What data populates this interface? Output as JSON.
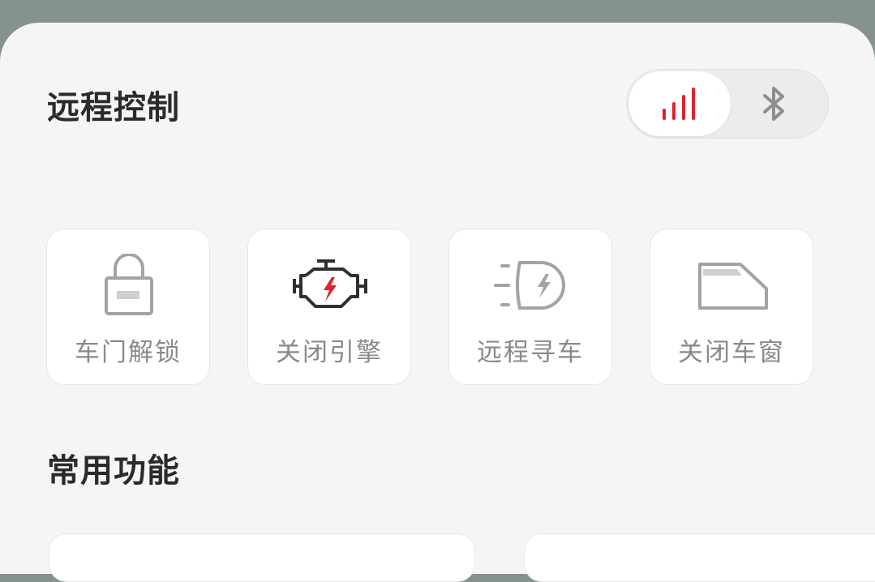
{
  "remote_control": {
    "title": "远程控制",
    "modes": [
      {
        "icon": "signal-icon",
        "active": true
      },
      {
        "icon": "bluetooth-icon",
        "active": false
      }
    ],
    "buttons": [
      {
        "label": "车门解锁",
        "icon": "padlock-icon"
      },
      {
        "label": "关闭引擎",
        "icon": "engine-icon"
      },
      {
        "label": "远程寻车",
        "icon": "headlight-icon"
      },
      {
        "label": "关闭车窗",
        "icon": "car-window-icon"
      }
    ]
  },
  "common_functions": {
    "title": "常用功能"
  },
  "colors": {
    "accent": "#e0242f",
    "icon_gray": "#a3a3a3",
    "icon_dark": "#2f2f2f",
    "title": "#2b2b2b",
    "label": "#8a8a8a"
  }
}
